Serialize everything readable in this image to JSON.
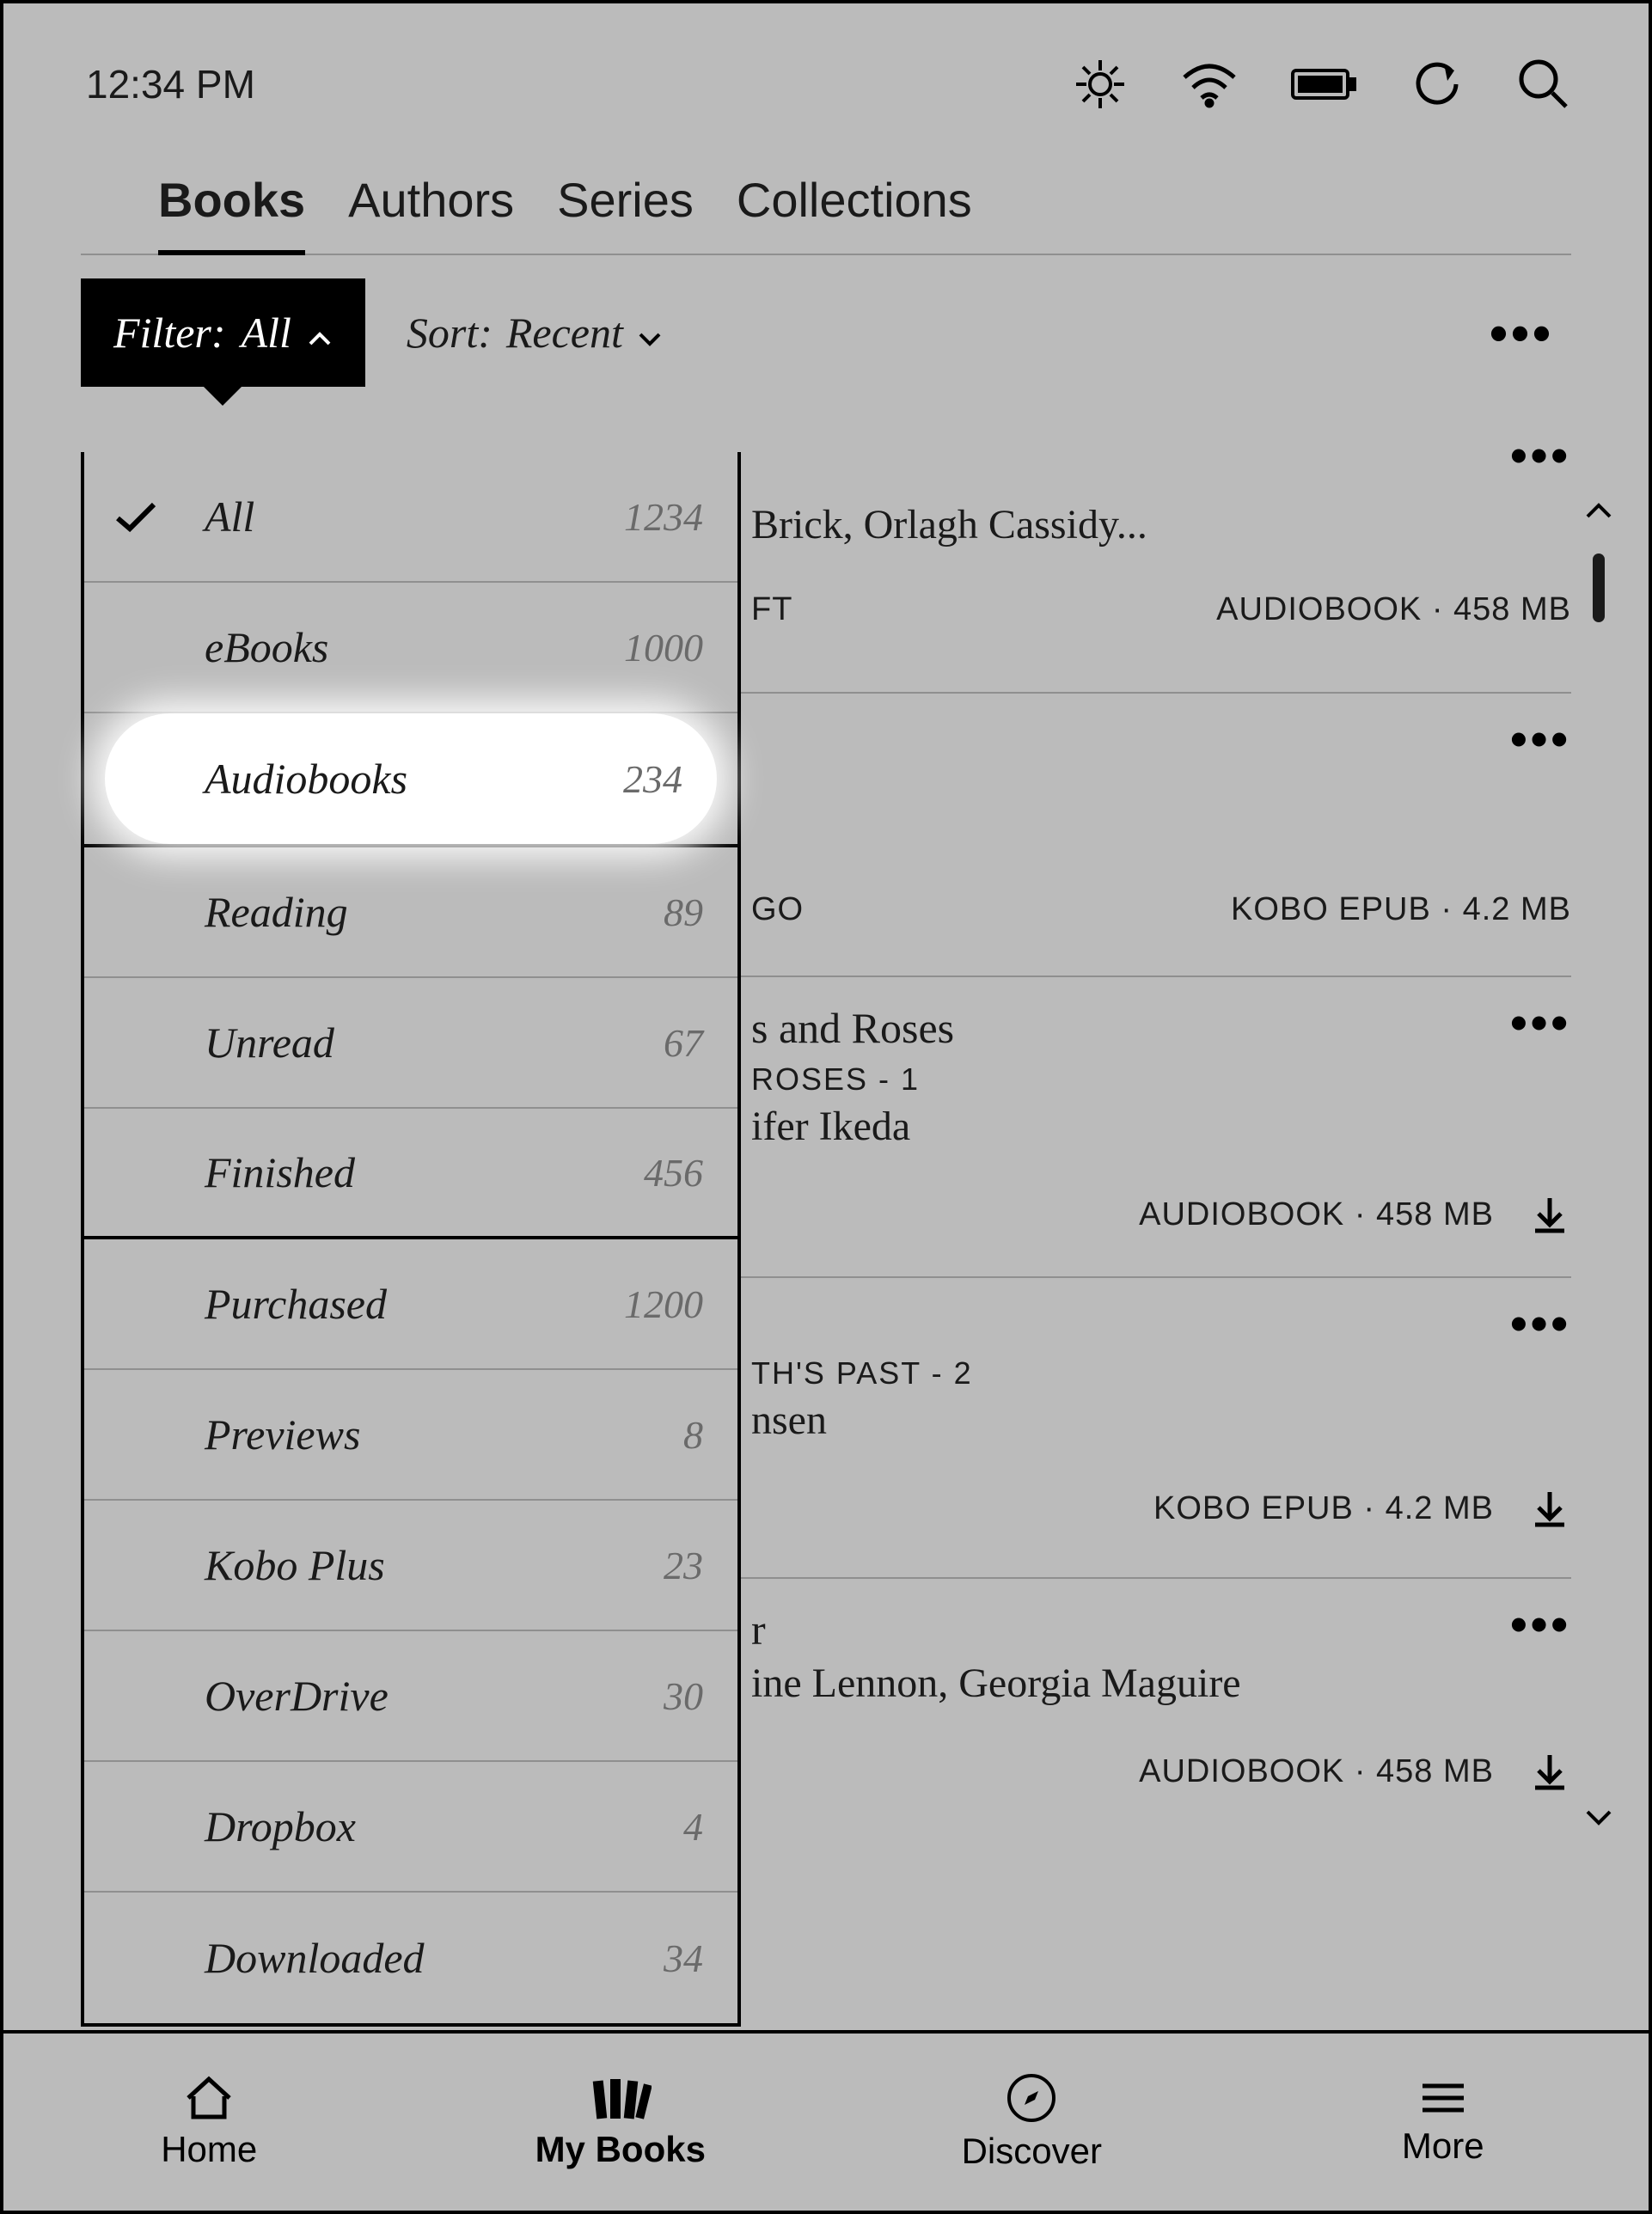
{
  "status": {
    "time": "12:34 PM"
  },
  "tabs": {
    "items": [
      "Books",
      "Authors",
      "Series",
      "Collections"
    ],
    "active": 0
  },
  "filter": {
    "label_prefix": "Filter:",
    "current": "All"
  },
  "sort": {
    "label_prefix": "Sort:",
    "current": "Recent"
  },
  "filter_options": [
    {
      "label": "All",
      "count": "1234",
      "checked": true,
      "separator": false
    },
    {
      "label": "eBooks",
      "count": "1000",
      "checked": false,
      "separator": false
    },
    {
      "label": "Audiobooks",
      "count": "234",
      "checked": false,
      "separator": true,
      "highlight": true
    },
    {
      "label": "Reading",
      "count": "89",
      "checked": false,
      "separator": false
    },
    {
      "label": "Unread",
      "count": "67",
      "checked": false,
      "separator": false
    },
    {
      "label": "Finished",
      "count": "456",
      "checked": false,
      "separator": true
    },
    {
      "label": "Purchased",
      "count": "1200",
      "checked": false,
      "separator": false
    },
    {
      "label": "Previews",
      "count": "8",
      "checked": false,
      "separator": false
    },
    {
      "label": "Kobo Plus",
      "count": "23",
      "checked": false,
      "separator": false
    },
    {
      "label": "OverDrive",
      "count": "30",
      "checked": false,
      "separator": false
    },
    {
      "label": "Dropbox",
      "count": "4",
      "checked": false,
      "separator": false
    },
    {
      "label": "Downloaded",
      "count": "34",
      "checked": false,
      "separator": false
    }
  ],
  "books": [
    {
      "title_fragment": "",
      "narrator_fragment": "Brick, Orlagh Cassidy...",
      "series_fragment": "FT",
      "meta": "AUDIOBOOK · 458 MB",
      "download": false
    },
    {
      "title_fragment": "",
      "narrator_fragment": "",
      "series_fragment": "GO",
      "meta": "KOBO EPUB · 4.2 MB",
      "download": false
    },
    {
      "title_fragment": "s and Roses",
      "series_fragment": "ROSES - 1",
      "narrator_fragment": "ifer Ikeda",
      "meta": "AUDIOBOOK · 458 MB",
      "download": true
    },
    {
      "title_fragment": "",
      "series_fragment": "TH'S PAST - 2",
      "narrator_fragment": "nsen",
      "meta": "KOBO EPUB · 4.2 MB",
      "download": true
    },
    {
      "title_fragment": "r",
      "series_fragment": "",
      "narrator_fragment": "ine Lennon, Georgia Maguire",
      "meta": "AUDIOBOOK · 458 MB",
      "download": true
    }
  ],
  "bottom_nav": {
    "items": [
      "Home",
      "My Books",
      "Discover",
      "More"
    ],
    "active": 1
  }
}
